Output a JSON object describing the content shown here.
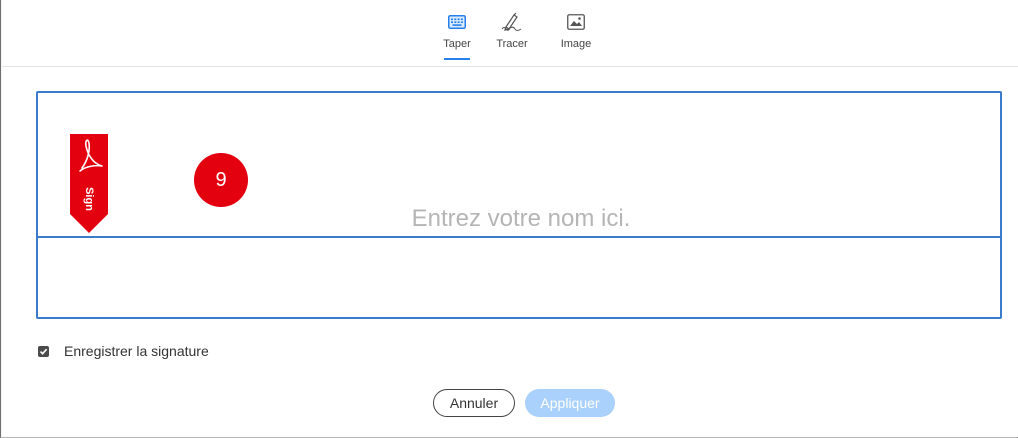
{
  "tabs": [
    {
      "label": "Taper",
      "icon": "keyboard-icon",
      "active": true
    },
    {
      "label": "Tracer",
      "icon": "pen-draw-icon",
      "active": false
    },
    {
      "label": "Image",
      "icon": "image-icon",
      "active": false
    }
  ],
  "signature": {
    "placeholder": "Entrez votre nom ici.",
    "value": "",
    "flag_text": "Sign",
    "step_number": "9"
  },
  "save_signature": {
    "label": "Enregistrer la signature",
    "checked": true
  },
  "buttons": {
    "cancel": "Annuler",
    "apply": "Appliquer"
  },
  "colors": {
    "accent": "#2680eb",
    "box_border": "#3b7bc9",
    "apply_disabled": "#a9d1fb",
    "flag_red": "#e3000f",
    "badge_red": "#e3000f"
  }
}
